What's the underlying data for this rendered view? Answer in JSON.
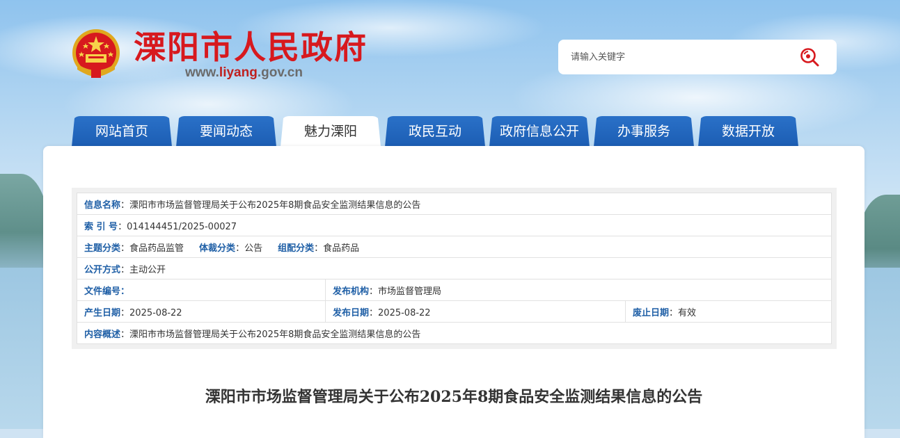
{
  "header": {
    "site_title": "溧阳市人民政府",
    "domain_prefix": "www.",
    "domain_mid": "liyang",
    "domain_suffix": ".gov.cn",
    "emblem_icon": "national-emblem-icon"
  },
  "search": {
    "placeholder": "请输入关键字",
    "icon": "search-icon",
    "icon_color": "#d7191e"
  },
  "nav": {
    "items": [
      {
        "label": "网站首页"
      },
      {
        "label": "要闻动态"
      },
      {
        "label": "魅力溧阳",
        "active": true
      },
      {
        "label": "政民互动"
      },
      {
        "label": "政府信息公开"
      },
      {
        "label": "办事服务"
      },
      {
        "label": "数据开放"
      }
    ],
    "tab_color": "#1f62b9"
  },
  "meta": {
    "name_label": "信息名称",
    "name_value": "溧阳市市场监督管理局关于公布2025年8期食品安全监测结果信息的公告",
    "index_label": "索 引 号",
    "index_value": "014144451/2025-00027",
    "topic_label": "主题分类",
    "topic_value": "食品药品监管",
    "genre_label": "体裁分类",
    "genre_value": "公告",
    "group_label": "组配分类",
    "group_value": "食品药品",
    "open_label": "公开方式",
    "open_value": "主动公开",
    "docno_label": "文件编号",
    "docno_value": "",
    "org_label": "发布机构",
    "org_value": "市场监督管理局",
    "created_label": "产生日期",
    "created_value": "2025-08-22",
    "published_label": "发布日期",
    "published_value": "2025-08-22",
    "expire_label": "废止日期",
    "expire_value": "有效",
    "summary_label": "内容概述",
    "summary_value": "溧阳市市场监督管理局关于公布2025年8期食品安全监测结果信息的公告",
    "colon": "："
  },
  "article": {
    "title": "溧阳市市场监督管理局关于公布2025年8期食品安全监测结果信息的公告"
  }
}
